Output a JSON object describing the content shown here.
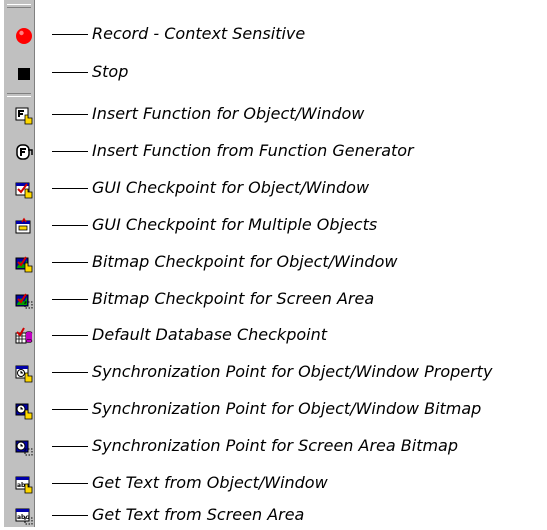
{
  "items": [
    {
      "label": "Record - Context Sensitive",
      "icon": "record-icon"
    },
    {
      "label": "Stop",
      "icon": "stop-icon"
    },
    {
      "label": "Insert Function for Object/Window",
      "icon": "insert-function-object-icon"
    },
    {
      "label": "Insert Function from Function Generator",
      "icon": "function-generator-icon"
    },
    {
      "label": "GUI Checkpoint for Object/Window",
      "icon": "gui-checkpoint-object-icon"
    },
    {
      "label": "GUI Checkpoint for Multiple Objects",
      "icon": "gui-checkpoint-multiple-icon"
    },
    {
      "label": "Bitmap Checkpoint for Object/Window",
      "icon": "bitmap-checkpoint-object-icon"
    },
    {
      "label": "Bitmap Checkpoint for Screen Area",
      "icon": "bitmap-checkpoint-area-icon"
    },
    {
      "label": "Default Database Checkpoint",
      "icon": "database-checkpoint-icon"
    },
    {
      "label": "Synchronization Point for Object/Window Property",
      "icon": "sync-property-icon"
    },
    {
      "label": "Synchronization Point for Object/Window Bitmap",
      "icon": "sync-bitmap-object-icon"
    },
    {
      "label": "Synchronization Point for Screen Area Bitmap",
      "icon": "sync-bitmap-area-icon"
    },
    {
      "label": "Get Text from Object/Window",
      "icon": "get-text-object-icon"
    },
    {
      "label": "Get Text from Screen Area",
      "icon": "get-text-area-icon"
    }
  ],
  "colors": {
    "toolbar": "#c0c0c0",
    "record": "#ff0000",
    "stop": "#000000",
    "accent_yellow": "#ffd800",
    "accent_blue": "#0000a8",
    "accent_red": "#d00000"
  }
}
